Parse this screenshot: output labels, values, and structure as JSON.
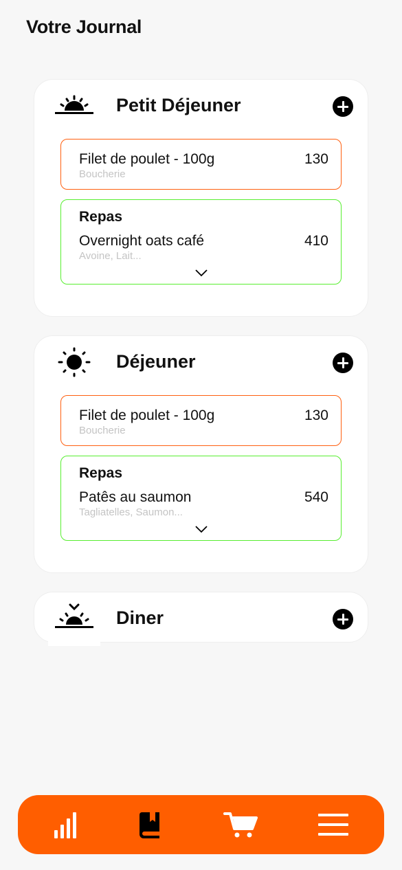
{
  "page": {
    "title": "Votre Journal"
  },
  "colors": {
    "accent": "#ff5e00",
    "ingredient_border": "#ff5f0f",
    "recipe_border": "#57ee2f",
    "subtitle": "#c4c4c4",
    "active_nav_icon": "#000000",
    "inactive_nav_icon": "#ffffff"
  },
  "meals": [
    {
      "title": "Petit Déjeuner",
      "icon": "sunrise-icon",
      "add_icon": "plus-circle-icon",
      "ingredient": {
        "name": "Filet de poulet - 100g",
        "kcal": "130",
        "category": "Boucherie"
      },
      "recipe": {
        "label": "Repas",
        "name": "Overnight oats café",
        "kcal": "410",
        "ingredients": "Avoine, Lait...",
        "chevron_icon": "chevron-down-icon"
      }
    },
    {
      "title": "Déjeuner",
      "icon": "sun-icon",
      "add_icon": "plus-circle-icon",
      "ingredient": {
        "name": "Filet de poulet - 100g",
        "kcal": "130",
        "category": "Boucherie"
      },
      "recipe": {
        "label": "Repas",
        "name": "Patês au saumon",
        "kcal": "540",
        "ingredients": "Tagliatelles, Saumon...",
        "chevron_icon": "chevron-down-icon"
      }
    },
    {
      "title": "Diner",
      "icon": "sunset-icon",
      "add_icon": "plus-circle-icon"
    }
  ],
  "bottom_nav": {
    "items": [
      {
        "icon": "stats-bars-icon",
        "active": false
      },
      {
        "icon": "journal-book-icon",
        "active": true
      },
      {
        "icon": "shopping-cart-icon",
        "active": false
      },
      {
        "icon": "menu-icon",
        "active": false
      }
    ]
  }
}
